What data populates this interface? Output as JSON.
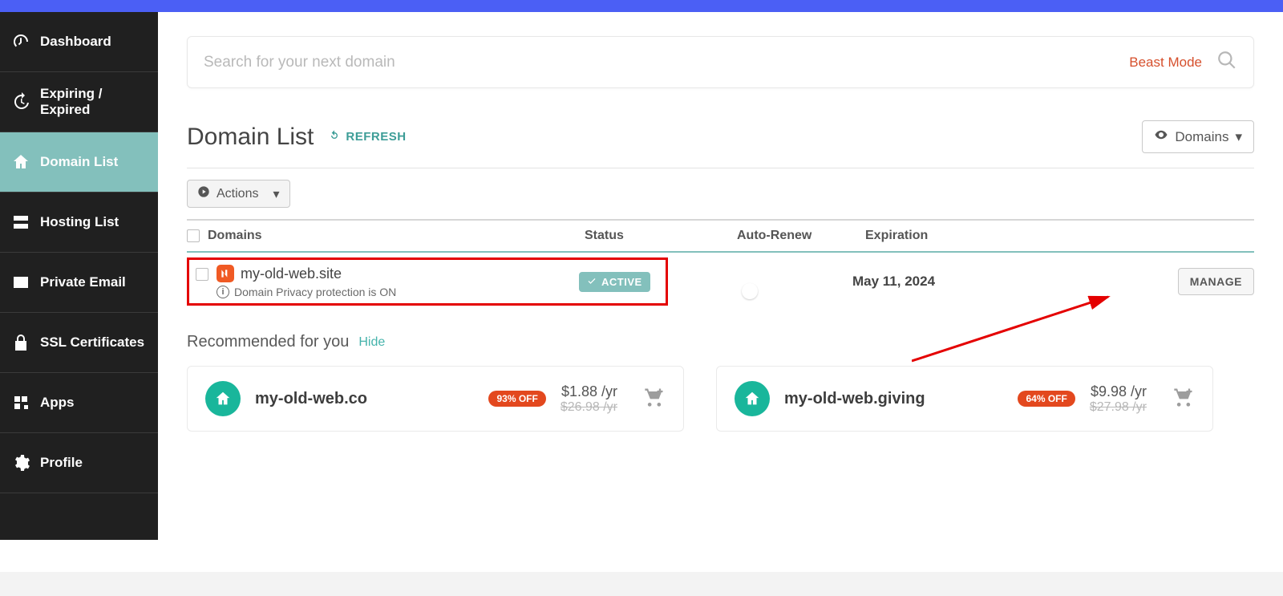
{
  "sidebar": {
    "items": [
      {
        "label": "Dashboard"
      },
      {
        "label": "Expiring / Expired"
      },
      {
        "label": "Domain List"
      },
      {
        "label": "Hosting List"
      },
      {
        "label": "Private Email"
      },
      {
        "label": "SSL Certificates"
      },
      {
        "label": "Apps"
      },
      {
        "label": "Profile"
      }
    ]
  },
  "search": {
    "placeholder": "Search for your next domain",
    "beast_mode": "Beast Mode"
  },
  "header": {
    "title": "Domain List",
    "refresh": "REFRESH",
    "filter_label": "Domains"
  },
  "actions": {
    "label": "Actions"
  },
  "table": {
    "cols": {
      "domain": "Domains",
      "status": "Status",
      "renew": "Auto-Renew",
      "exp": "Expiration"
    },
    "row": {
      "domain": "my-old-web.site",
      "privacy": "Domain Privacy protection is ON",
      "status": "ACTIVE",
      "expiration": "May 11, 2024",
      "manage": "MANAGE"
    }
  },
  "recommend": {
    "title": "Recommended for you",
    "hide": "Hide",
    "cards": [
      {
        "name": "my-old-web.co",
        "discount": "93% OFF",
        "price": "$1.88 /yr",
        "old_price": "$26.98 /yr"
      },
      {
        "name": "my-old-web.giving",
        "discount": "64% OFF",
        "price": "$9.98 /yr",
        "old_price": "$27.98 /yr"
      }
    ]
  }
}
